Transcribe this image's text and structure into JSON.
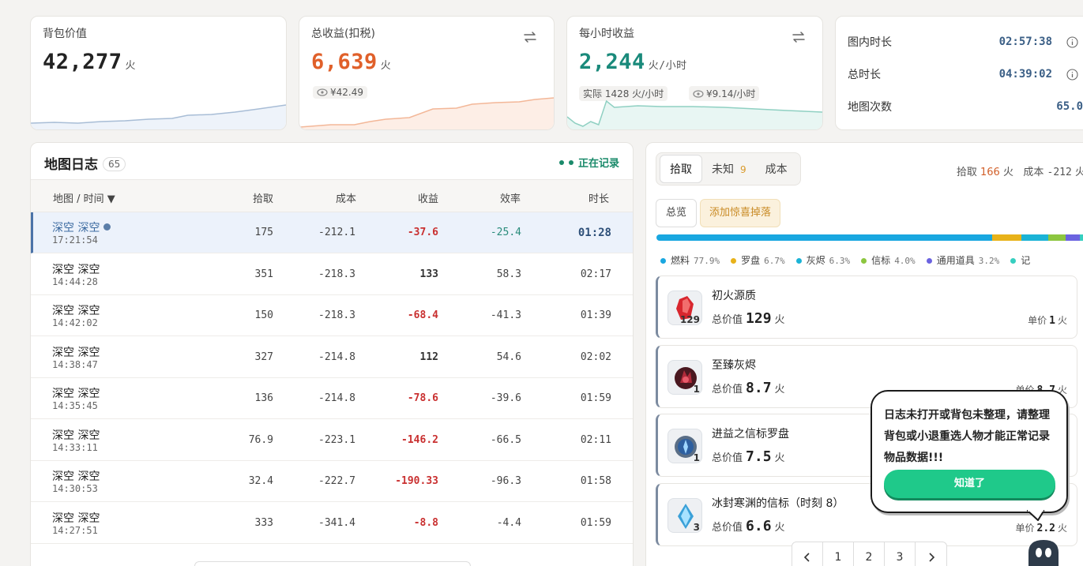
{
  "stats": {
    "bag": {
      "label": "背包价值",
      "value": "42,277",
      "unit": "火"
    },
    "total": {
      "label": "总收益(扣税)",
      "value": "6,639",
      "unit": "火",
      "rmb": "¥42.49",
      "color": "#e0602a"
    },
    "hourly": {
      "label": "每小时收益",
      "value": "2,244",
      "unit": "火/小时",
      "actual": "实际 1428 火/小时",
      "rmb": "¥9.14/小时",
      "color": "#1a8a7b"
    },
    "timing": [
      {
        "label": "图内时长",
        "value": "02:57:38"
      },
      {
        "label": "总时长",
        "value": "04:39:02"
      },
      {
        "label": "地图次数",
        "value": "65.0"
      }
    ]
  },
  "log": {
    "title": "地图日志",
    "count": "65",
    "status": "正在记录",
    "columns": {
      "map": "地图 / 时间 ▼",
      "pickup": "拾取",
      "cost": "成本",
      "profit": "收益",
      "eff": "效率",
      "dur": "时长"
    },
    "rows": [
      {
        "name": "深空 深空",
        "time": "17:21:54",
        "pickup": "175",
        "cost": "-212.1",
        "profit": "-37.6",
        "eff": "-25.4",
        "dur": "01:28"
      },
      {
        "name": "深空 深空",
        "time": "14:44:28",
        "pickup": "351",
        "cost": "-218.3",
        "profit": "133",
        "eff": "58.3",
        "dur": "02:17"
      },
      {
        "name": "深空 深空",
        "time": "14:42:02",
        "pickup": "150",
        "cost": "-218.3",
        "profit": "-68.4",
        "eff": "-41.3",
        "dur": "01:39"
      },
      {
        "name": "深空 深空",
        "time": "14:38:47",
        "pickup": "327",
        "cost": "-214.8",
        "profit": "112",
        "eff": "54.6",
        "dur": "02:02"
      },
      {
        "name": "深空 深空",
        "time": "14:35:45",
        "pickup": "136",
        "cost": "-214.8",
        "profit": "-78.6",
        "eff": "-39.6",
        "dur": "01:59"
      },
      {
        "name": "深空 深空",
        "time": "14:33:11",
        "pickup": "76.9",
        "cost": "-223.1",
        "profit": "-146.2",
        "eff": "-66.5",
        "dur": "02:11"
      },
      {
        "name": "深空 深空",
        "time": "14:30:53",
        "pickup": "32.4",
        "cost": "-222.7",
        "profit": "-190.33",
        "eff": "-96.3",
        "dur": "01:58"
      },
      {
        "name": "深空 深空",
        "time": "14:27:51",
        "pickup": "333",
        "cost": "-341.4",
        "profit": "-8.8",
        "eff": "-4.4",
        "dur": "01:59"
      }
    ]
  },
  "drops": {
    "tabs": [
      {
        "label": "拾取"
      },
      {
        "label": "未知",
        "count": "9"
      },
      {
        "label": "成本"
      }
    ],
    "summary": {
      "pickup_label": "拾取",
      "pickup_value": "166",
      "unit": "火",
      "cost_label": "成本",
      "cost_value": "-212",
      "unit2": "火"
    },
    "overview_btn": "总览",
    "add_btn": "添加惊喜掉落",
    "segments": [
      {
        "name": "燃料",
        "pct": "77.9%",
        "value": 77.9,
        "color": "#19a7e0"
      },
      {
        "name": "罗盘",
        "pct": "6.7%",
        "value": 6.7,
        "color": "#e8b21a"
      },
      {
        "name": "灰烬",
        "pct": "6.3%",
        "value": 6.3,
        "color": "#1bb3d6"
      },
      {
        "name": "信标",
        "pct": "4.0%",
        "value": 4.0,
        "color": "#8cc63f"
      },
      {
        "name": "通用道具",
        "pct": "3.2%",
        "value": 3.2,
        "color": "#6b63e0"
      },
      {
        "name": "记",
        "pct": "",
        "value": 1.9,
        "color": "#36cfc0"
      }
    ],
    "total_label": "总价值",
    "unit_label": "单价",
    "fire": "火",
    "items": [
      {
        "name": "初火源质",
        "qty": "129",
        "total": "129",
        "unit": "1",
        "icon": "red-crystal-icon",
        "color": "#d8262e"
      },
      {
        "name": "至臻灰烬",
        "qty": "1",
        "total": "8.7",
        "unit": "8.7",
        "icon": "ember-icon",
        "color": "#7a1f2a"
      },
      {
        "name": "进益之信标罗盘",
        "qty": "1",
        "total": "7.5",
        "unit": "",
        "icon": "compass-icon",
        "color": "#2d5fa0"
      },
      {
        "name": "冰封寒渊的信标（时刻 8）",
        "qty": "3",
        "total": "6.6",
        "unit": "2.2",
        "icon": "ice-beacon-icon",
        "color": "#3aa0d8"
      }
    ],
    "pages": [
      "1",
      "2",
      "3"
    ]
  },
  "popup": {
    "text": "日志未打开或背包未整理，请整理背包或小退重选人物才能正常记录物品数据!!!",
    "button": "知道了"
  }
}
